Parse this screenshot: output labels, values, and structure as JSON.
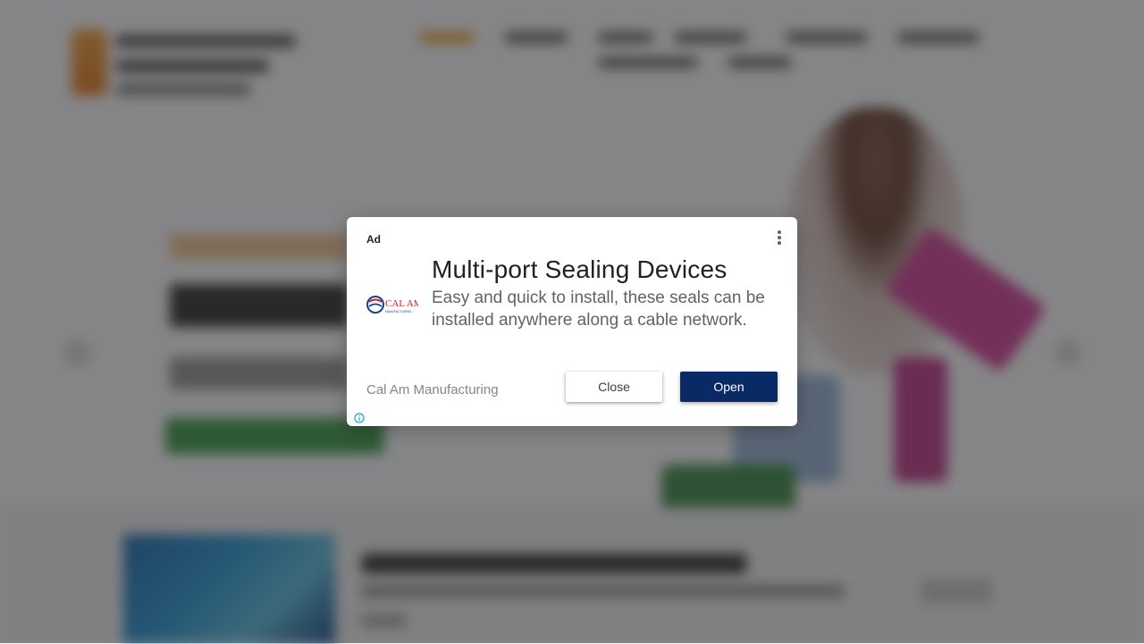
{
  "ad": {
    "label": "Ad",
    "headline": "Multi-port Sealing Devices",
    "description": "Easy and quick to install, these seals can be installed anywhere along a cable network.",
    "advertiser": "Cal Am Manufacturing",
    "logo_text": "CAL AM",
    "logo_subtext": "MANUFACTURING",
    "close_label": "Close",
    "open_label": "Open",
    "icons": {
      "menu": "more-vert-icon",
      "info": "info-icon"
    },
    "colors": {
      "open_button": "#0a2a66",
      "info_icon": "#1aa3d9",
      "logo_red": "#c8242b",
      "logo_blue": "#1c3f8c"
    }
  },
  "background": {
    "accent": "#f0a030",
    "cta_green": "#3f9f46"
  }
}
